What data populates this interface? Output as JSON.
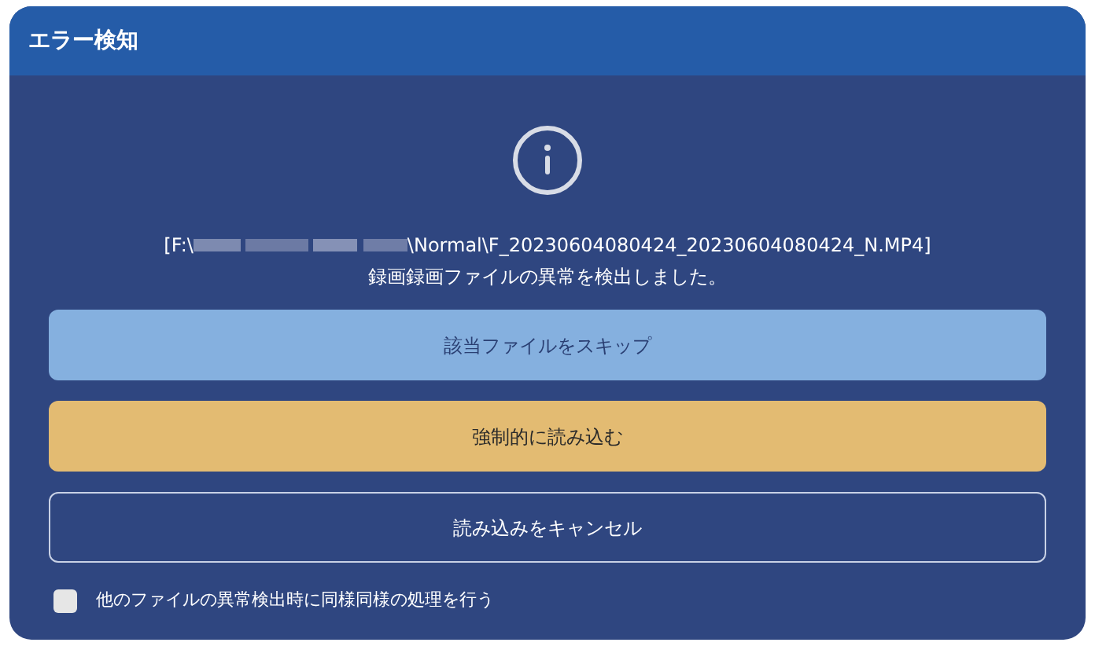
{
  "dialog": {
    "title": "エラー検知",
    "path_start": "[F:\\",
    "path_end": "\\Normal\\F_20230604080424_20230604080424_N.MP4]",
    "message": "録画録画ファイルの異常を検出しました。",
    "buttons": [
      {
        "label": "該当ファイルをスキップ",
        "kind": "primary"
      },
      {
        "label": "強制的に読み込む",
        "kind": "warning"
      },
      {
        "label": "読み込みをキャンセル",
        "kind": "outline"
      }
    ],
    "option": {
      "label": "他のファイルの異常検出時に同様同様の処理を行う",
      "checked": false
    }
  }
}
